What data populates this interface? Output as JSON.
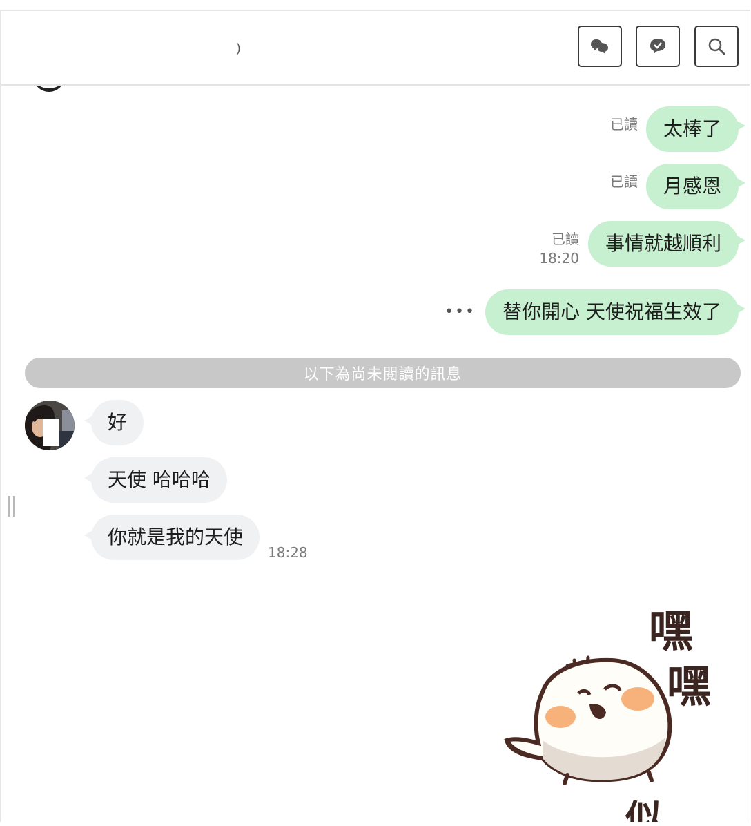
{
  "header": {
    "title": ")",
    "buttons": [
      {
        "name": "chat-bubbles-icon"
      },
      {
        "name": "check-bubble-icon"
      },
      {
        "name": "search-icon"
      }
    ]
  },
  "outgoing": [
    {
      "text": "太棒了",
      "read": "已讀",
      "time": ""
    },
    {
      "text": "月感恩",
      "read": "已讀",
      "time": ""
    },
    {
      "text": "事情就越順利",
      "read": "已讀",
      "time": "18:20"
    },
    {
      "text": "替你開心 天使祝福生效了",
      "status": "•••"
    }
  ],
  "unread_divider": "以下為尚未閱讀的訊息",
  "incoming": [
    {
      "text": "好"
    },
    {
      "text": "天使 哈哈哈"
    },
    {
      "text": "你就是我的天使",
      "time": "18:28"
    }
  ],
  "sticker": {
    "text_top": "嘿",
    "text_bottom": "嘿",
    "text_bottom_partial": "似"
  },
  "colors": {
    "outgoing_bubble": "#c6f0cf",
    "incoming_bubble": "#f0f1f3",
    "divider": "#c8c8c8"
  }
}
